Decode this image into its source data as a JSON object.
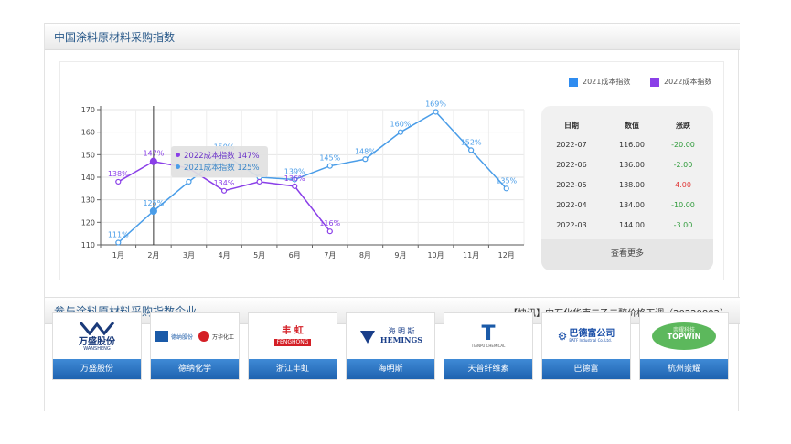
{
  "section1": {
    "title": "中国涂料原材料采购指数"
  },
  "chart_data": {
    "type": "line",
    "categories": [
      "1月",
      "2月",
      "3月",
      "4月",
      "5月",
      "6月",
      "7月",
      "8月",
      "9月",
      "10月",
      "11月",
      "12月"
    ],
    "ylim": [
      110,
      170
    ],
    "yticks": [
      110,
      120,
      130,
      140,
      150,
      160,
      170
    ],
    "series": [
      {
        "name": "2021成本指数",
        "color": "#4a9de8",
        "values": [
          111,
          125,
          138,
          150,
          140,
          139,
          145,
          148,
          160,
          169,
          152,
          135
        ],
        "labels": [
          "111%",
          "125%",
          "",
          "150%",
          "",
          "139%",
          "145%",
          "148%",
          "160%",
          "169%",
          "152%",
          "135%"
        ]
      },
      {
        "name": "2022成本指数",
        "color": "#8a3fe8",
        "values": [
          138,
          147,
          144,
          134,
          138,
          136,
          116
        ],
        "labels": [
          "138%",
          "147%",
          "",
          "134%",
          "",
          "136%",
          "116%"
        ]
      }
    ],
    "hover_index": 1,
    "tooltip": {
      "line1": "2022成本指数 147%",
      "line2": "2021成本指数 125%"
    },
    "grid": true,
    "legend": "top-right"
  },
  "table": {
    "headers": [
      "日期",
      "数值",
      "涨跌"
    ],
    "rows": [
      {
        "date": "2022-07",
        "value": "116.00",
        "change": "-20.00",
        "dir": "neg"
      },
      {
        "date": "2022-06",
        "value": "136.00",
        "change": "-2.00",
        "dir": "neg"
      },
      {
        "date": "2022-05",
        "value": "138.00",
        "change": "4.00",
        "dir": "pos"
      },
      {
        "date": "2022-04",
        "value": "134.00",
        "change": "-10.00",
        "dir": "neg"
      },
      {
        "date": "2022-03",
        "value": "144.00",
        "change": "-3.00",
        "dir": "neg"
      }
    ],
    "more": "查看更多"
  },
  "section2": {
    "title": "参与涂料原材料采购指数企业",
    "news": "【快讯】中石化华南二乙二醇价格下调（20220802）"
  },
  "companies": [
    {
      "name": "万盛股份",
      "logo_text": "万盛股份",
      "logo_sub": "WANSHENG",
      "color": "#1a3a7a"
    },
    {
      "name": "德纳化学",
      "logo_text": "德纳股份",
      "logo_sub": "万华化工",
      "color": "#1a5aa8"
    },
    {
      "name": "浙江丰虹",
      "logo_text": "丰  虹",
      "logo_sub": "FENGHONG",
      "color": "#d41f26"
    },
    {
      "name": "海明斯",
      "logo_text": "海 明 斯",
      "logo_sub": "HEMINGS",
      "color": "#1a3f8a"
    },
    {
      "name": "天普纤维素",
      "logo_text": "T",
      "logo_sub": "TIANPU CHEMICAL",
      "color": "#1a5aa8"
    },
    {
      "name": "巴德富",
      "logo_text": "巴德富公司",
      "logo_sub": "BATF Industrial Co.,Ltd.",
      "color": "#1a4fa8"
    },
    {
      "name": "杭州崇耀",
      "logo_text": "崇耀科技",
      "logo_sub": "TOPWIN",
      "color": "#3a9a3a"
    }
  ]
}
